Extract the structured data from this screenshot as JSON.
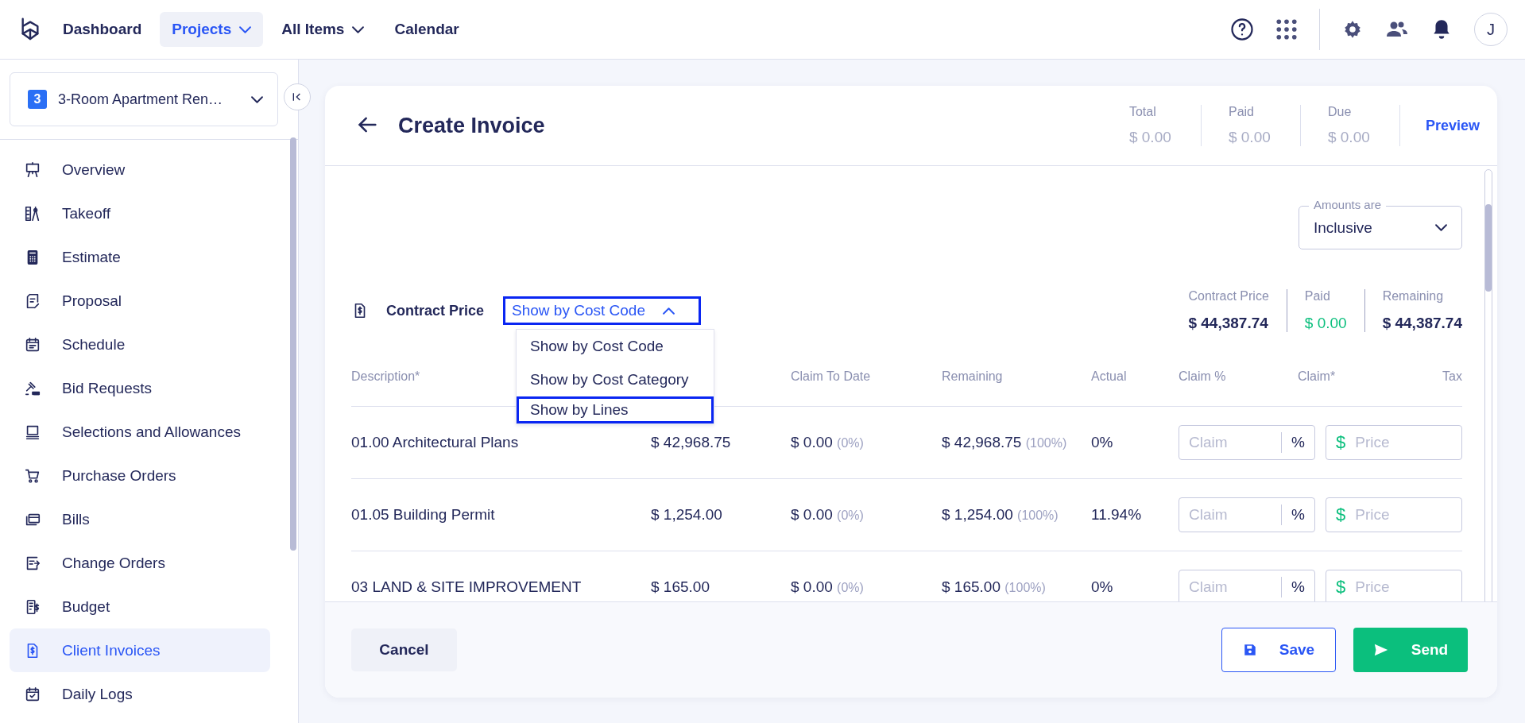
{
  "topnav": {
    "items": [
      {
        "label": "Dashboard",
        "selected": false,
        "has_menu": false
      },
      {
        "label": "Projects",
        "selected": true,
        "has_menu": true
      },
      {
        "label": "All Items",
        "selected": false,
        "has_menu": true
      },
      {
        "label": "Calendar",
        "selected": false,
        "has_menu": false
      }
    ],
    "avatar": "J"
  },
  "sidebar": {
    "project": {
      "badge": "3",
      "name": "3-Room Apartment Ren…"
    },
    "items": [
      {
        "label": "Overview",
        "selected": false
      },
      {
        "label": "Takeoff",
        "selected": false
      },
      {
        "label": "Estimate",
        "selected": false
      },
      {
        "label": "Proposal",
        "selected": false
      },
      {
        "label": "Schedule",
        "selected": false
      },
      {
        "label": "Bid Requests",
        "selected": false
      },
      {
        "label": "Selections and Allowances",
        "selected": false
      },
      {
        "label": "Purchase Orders",
        "selected": false
      },
      {
        "label": "Bills",
        "selected": false
      },
      {
        "label": "Change Orders",
        "selected": false
      },
      {
        "label": "Budget",
        "selected": false
      },
      {
        "label": "Client Invoices",
        "selected": true
      },
      {
        "label": "Daily Logs",
        "selected": false
      }
    ]
  },
  "invoice": {
    "title": "Create Invoice",
    "summary": [
      {
        "label": "Total",
        "value": "$ 0.00"
      },
      {
        "label": "Paid",
        "value": "$ 0.00"
      },
      {
        "label": "Due",
        "value": "$ 0.00"
      }
    ],
    "preview": "Preview",
    "amounts": {
      "label": "Amounts are",
      "value": "Inclusive"
    },
    "contract": {
      "label": "Contract Price",
      "view": "Show by Cost Code",
      "outlined": true,
      "expanded": true,
      "options": [
        {
          "label": "Show by Cost Code",
          "highlighted": false
        },
        {
          "label": "Show by Cost Category",
          "highlighted": false
        },
        {
          "label": "Show by Lines",
          "highlighted": true
        }
      ]
    },
    "totals": [
      {
        "label": "Contract Price",
        "value": "$ 44,387.74",
        "kind": "plain"
      },
      {
        "label": "Paid",
        "value": "$ 0.00",
        "kind": "paid"
      },
      {
        "label": "Remaining",
        "value": "$ 44,387.74",
        "kind": "plain"
      }
    ],
    "table": {
      "columns": [
        "Description*",
        "Claim To Date",
        "Remaining",
        "Actual",
        "Claim %",
        "Claim*",
        "Tax"
      ],
      "rows": [
        {
          "description": "01.00 Architectural Plans",
          "amount": "$ 42,968.75",
          "claim_to_date": "$ 0.00",
          "claim_to_date_pct": "(0%)",
          "remaining": "$ 42,968.75",
          "remaining_pct": "(100%)",
          "actual": "0%",
          "claim_placeholder": "Claim",
          "percent_sign": "%",
          "currency": "$",
          "price_placeholder": "Price"
        },
        {
          "description": "01.05 Building Permit",
          "amount": "$ 1,254.00",
          "claim_to_date": "$ 0.00",
          "claim_to_date_pct": "(0%)",
          "remaining": "$ 1,254.00",
          "remaining_pct": "(100%)",
          "actual": "11.94%",
          "claim_placeholder": "Claim",
          "percent_sign": "%",
          "currency": "$",
          "price_placeholder": "Price"
        },
        {
          "description": "03 LAND & SITE IMPROVEMENT",
          "amount": "$ 165.00",
          "claim_to_date": "$ 0.00",
          "claim_to_date_pct": "(0%)",
          "remaining": "$ 165.00",
          "remaining_pct": "(100%)",
          "actual": "0%",
          "claim_placeholder": "Claim",
          "percent_sign": "%",
          "currency": "$",
          "price_placeholder": "Price"
        }
      ]
    },
    "footer": {
      "cancel": "Cancel",
      "save": "Save",
      "send": "Send"
    }
  }
}
